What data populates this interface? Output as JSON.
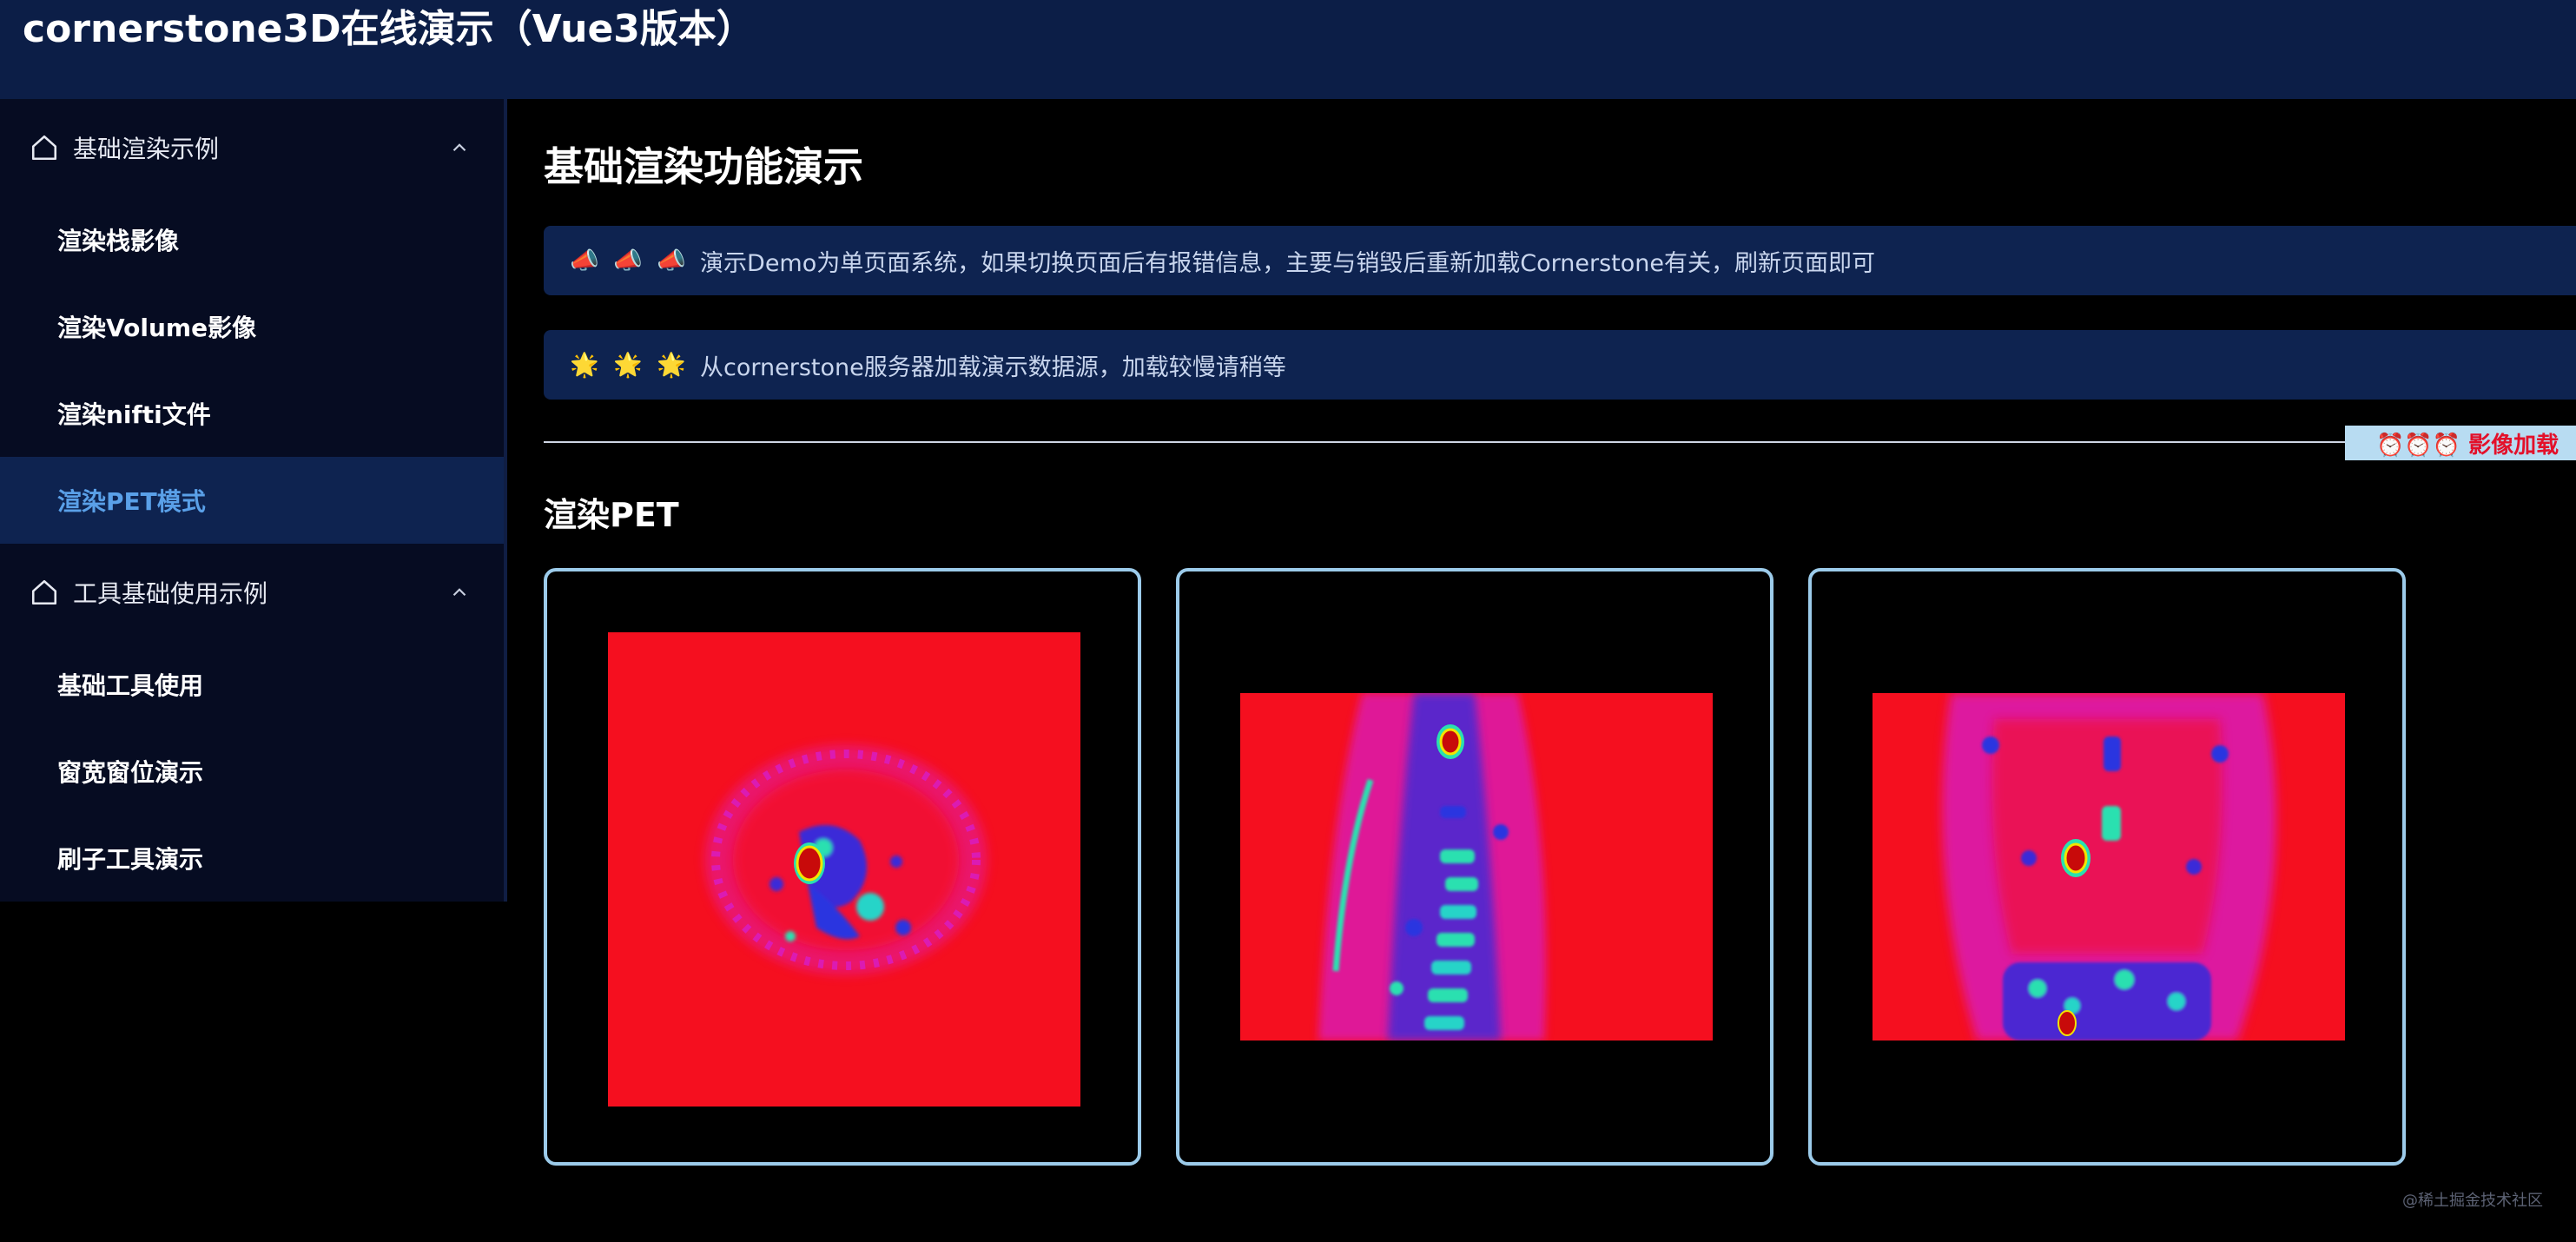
{
  "header": {
    "title": "cornerstone3D在线演示（Vue3版本）"
  },
  "sidebar": {
    "groups": [
      {
        "label": "基础渲染示例",
        "icon": "home-icon",
        "expanded": true,
        "items": [
          {
            "label": "渲染栈影像",
            "active": false
          },
          {
            "label": "渲染Volume影像",
            "active": false
          },
          {
            "label": "渲染nifti文件",
            "active": false
          },
          {
            "label": "渲染PET模式",
            "active": true
          }
        ]
      },
      {
        "label": "工具基础使用示例",
        "icon": "home-icon",
        "expanded": true,
        "items": [
          {
            "label": "基础工具使用",
            "active": false
          },
          {
            "label": "窗宽窗位演示",
            "active": false
          },
          {
            "label": "刷子工具演示",
            "active": false
          }
        ]
      }
    ]
  },
  "main": {
    "title": "基础渲染功能演示",
    "notices": [
      {
        "icons": "📣 📣 📣",
        "text": "演示Demo为单页面系统，如果切换页面后有报错信息，主要与销毁后重新加载Cornerstone有关，刷新页面即可"
      },
      {
        "icons": "🌟 🌟 🌟",
        "text": "从cornerstone服务器加载演示数据源，加载较慢请稍等"
      }
    ],
    "loading_badge": "⏰⏰⏰ 影像加载",
    "section_title": "渲染PET",
    "viewports": [
      {
        "view": "axial"
      },
      {
        "view": "sagittal"
      },
      {
        "view": "coronal"
      }
    ]
  },
  "colors": {
    "header_bg": "#0c1e47",
    "sidebar_bg": "#060c22",
    "active_item_bg": "#0e2350",
    "active_item_text": "#5aa0e8",
    "notice_bg": "#0e2350",
    "viewport_border": "#9ccbea",
    "pet_background": "#f50f1f",
    "loading_badge_bg": "#b8dcf2",
    "loading_badge_text": "#e3102a"
  },
  "watermark": "@稀土掘金技术社区"
}
